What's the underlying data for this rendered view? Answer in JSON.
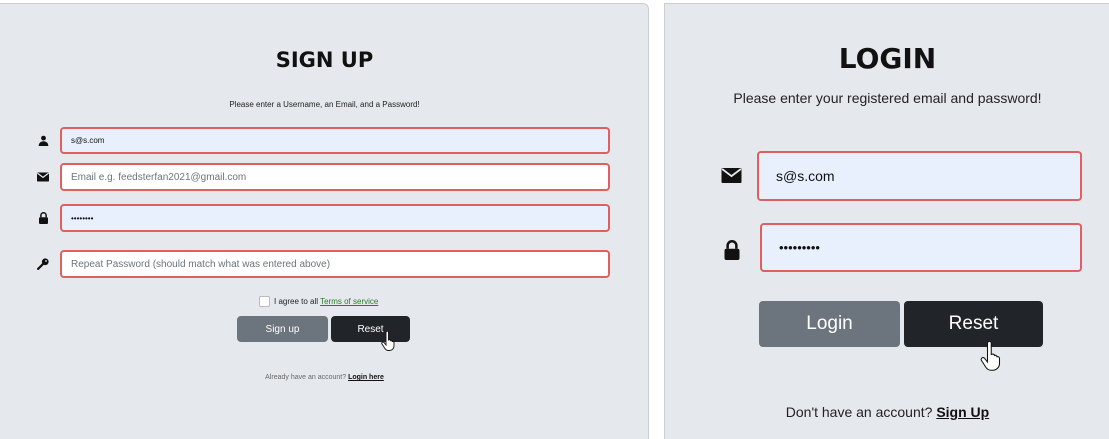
{
  "signup": {
    "title": "SIGN UP",
    "subtitle": "Please enter a Username, an Email, and a Password!",
    "username_value": "s@s.com",
    "email_placeholder": "Email e.g. feedsterfan2021@gmail.com",
    "password_value": "••••••••",
    "repeat_password_placeholder": "Repeat Password (should match what was entered above)",
    "terms_prefix": "I agree to all",
    "terms_link": "Terms of service",
    "signup_button": "Sign up",
    "reset_button": "Reset",
    "account_prompt": "Already have an account?",
    "login_link": "Login here"
  },
  "login": {
    "title": "LOGIN",
    "subtitle": "Please enter your registered email and password!",
    "email_value": "s@s.com",
    "password_value": "•••••••••",
    "login_button": "Login",
    "reset_button": "Reset",
    "account_prompt": "Don't have an account?",
    "signup_link": "Sign Up"
  },
  "icons": {
    "user": "user-icon",
    "envelope": "envelope-icon",
    "lock": "lock-icon",
    "key": "key-icon",
    "pointer": "hand-pointer-cursor"
  },
  "colors": {
    "panel_bg": "#e5e9ed",
    "field_border_error": "#e06060",
    "field_filled_bg": "#e8effd",
    "button_secondary": "#6c757d",
    "button_dark": "#212529",
    "terms_link": "#2d7a2d"
  }
}
